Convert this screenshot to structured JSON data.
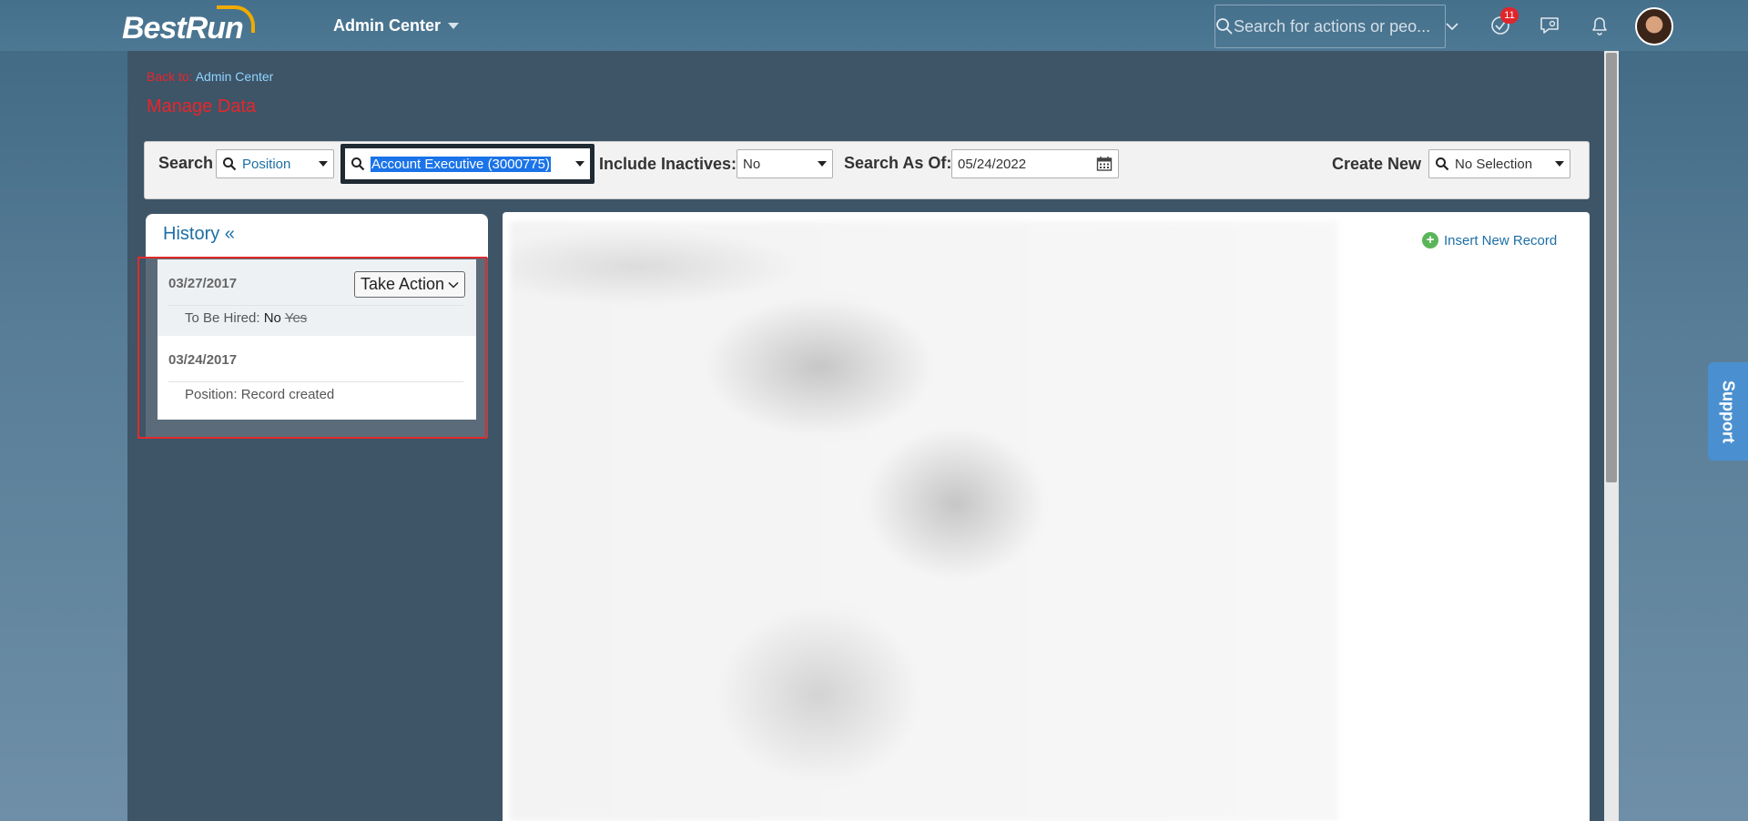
{
  "header": {
    "logo": "BestRun",
    "module_title": "Admin Center",
    "search_placeholder": "Search for actions or peo...",
    "notification_count": "11"
  },
  "breadcrumb": {
    "prefix": "Back to:",
    "link": "Admin Center"
  },
  "page_title": "Manage Data",
  "searchbar": {
    "search_label": "Search",
    "object_type": "Position",
    "selected_record": "Account Executive (3000775)",
    "include_inactives_label": "Include Inactives:",
    "include_inactives_value": "No",
    "search_as_of_label": "Search As Of:",
    "search_as_of_value": "05/24/2022",
    "create_new_label": "Create New",
    "create_new_value": "No Selection"
  },
  "history": {
    "title": "History «",
    "take_action_label": "Take Action",
    "entries": [
      {
        "date": "03/27/2017",
        "field": "To Be Hired:",
        "new_value": "No",
        "old_value": "Yes"
      },
      {
        "date": "03/24/2017",
        "field": "Position:",
        "new_value": "Record created"
      }
    ]
  },
  "detail": {
    "insert_new_record": "Insert New Record"
  },
  "support_tab": "Support",
  "colors": {
    "brand_red": "#e8262b",
    "link_blue": "#1d6fa5",
    "selection_blue": "#1a73e8",
    "highlight_box": "#e02b2b"
  }
}
